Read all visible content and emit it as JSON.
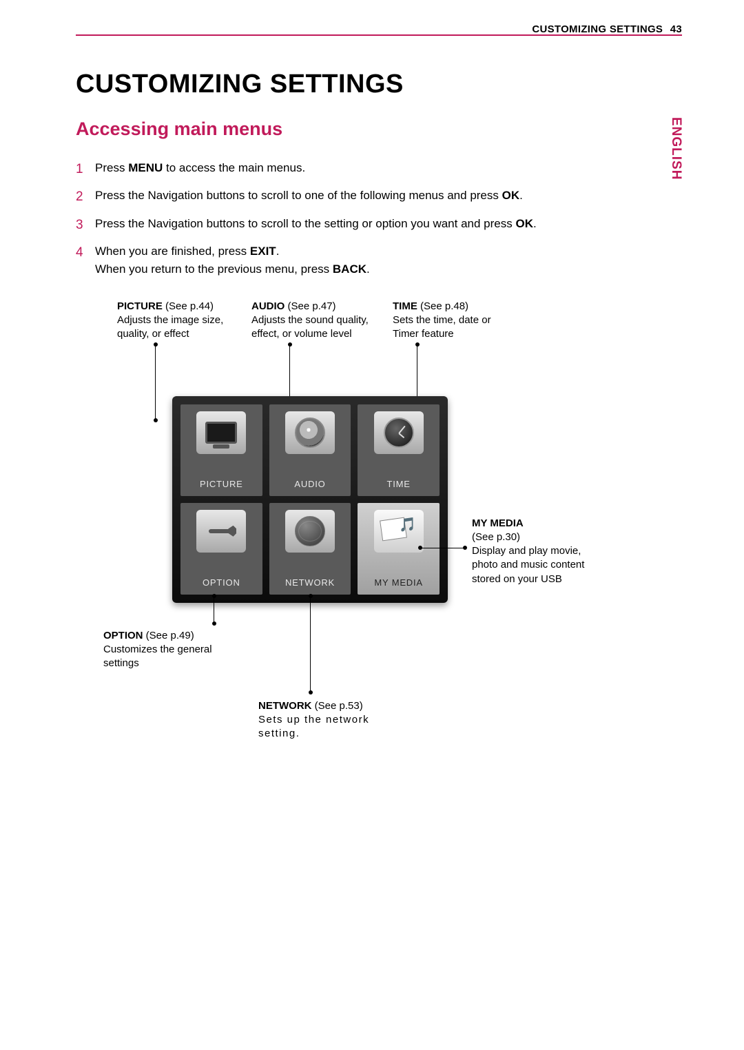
{
  "runningHead": {
    "label": "CUSTOMIZING SETTINGS",
    "page": "43"
  },
  "sideTab": "ENGLISH",
  "title": "CUSTOMIZING SETTINGS",
  "section": "Accessing main menus",
  "steps": [
    {
      "pre": "Press ",
      "b1": "MENU",
      "post": " to access the main menus."
    },
    {
      "pre": "Press the Navigation buttons to scroll to one of the following menus and press ",
      "b1": "OK",
      "post": "."
    },
    {
      "pre": "Press the Navigation buttons to scroll to the setting or option you want and press ",
      "b1": "OK",
      "post": "."
    },
    {
      "pre": "When you are finished, press ",
      "b1": "EXIT",
      "mid": ".\nWhen you return to the previous menu, press ",
      "b2": "BACK",
      "post": "."
    }
  ],
  "menu": {
    "picture": "PICTURE",
    "audio": "AUDIO",
    "time": "TIME",
    "option": "OPTION",
    "network": "NETWORK",
    "mymedia": "MY MEDIA"
  },
  "callouts": {
    "picture": {
      "title": "PICTURE",
      "ref": " (See p.44)",
      "desc": "Adjusts the image size, quality, or effect"
    },
    "audio": {
      "title": "AUDIO",
      "ref": " (See p.47)",
      "desc": "Adjusts the sound quality, effect, or volume level"
    },
    "time": {
      "title": "TIME",
      "ref": " (See p.48)",
      "desc": "Sets the time, date or Timer feature"
    },
    "option": {
      "title": "OPTION",
      "ref": " (See p.49)",
      "desc": "Customizes the general settings"
    },
    "network": {
      "title": "NETWORK",
      "ref": " (See p.53)",
      "desc": "Sets up the network setting."
    },
    "mymedia": {
      "title": "MY MEDIA",
      "ref": "(See p.30)",
      "desc": "Display and play movie, photo and music content stored on your USB"
    }
  }
}
